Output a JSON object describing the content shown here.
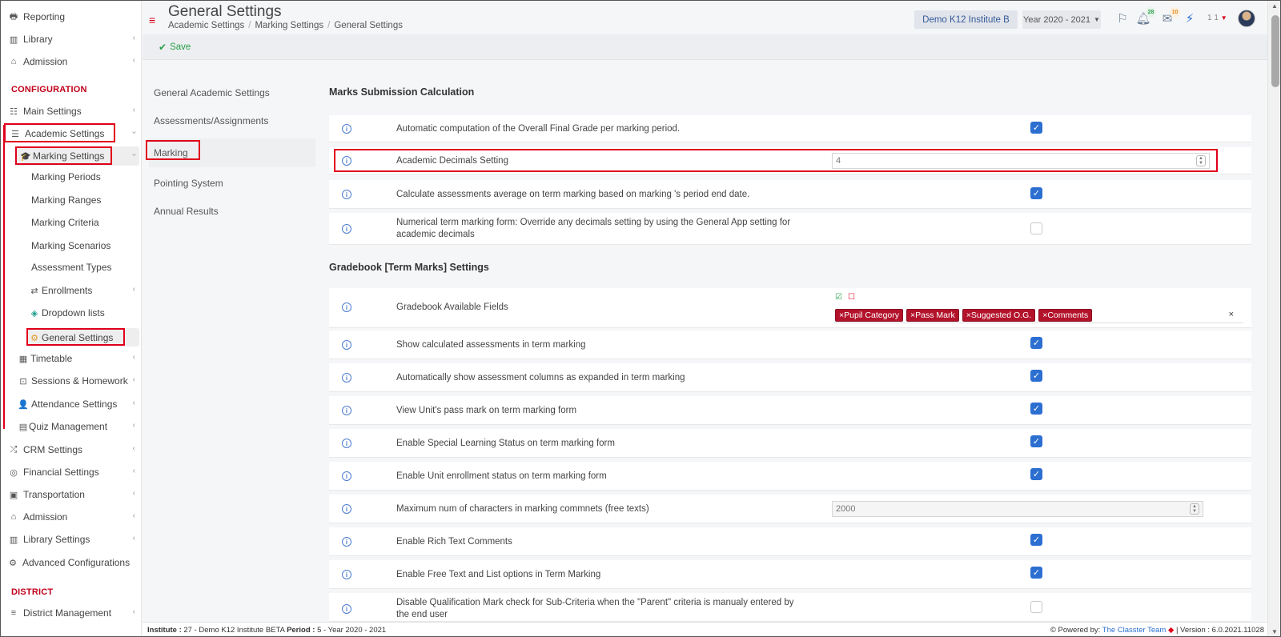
{
  "sidebar": {
    "top_items": [
      {
        "label": "Reporting",
        "icon": "printer-icon"
      },
      {
        "label": "Library",
        "icon": "library-icon"
      },
      {
        "label": "Admission",
        "icon": "institution-icon"
      }
    ],
    "section_configuration": "CONFIGURATION",
    "main_settings": "Main Settings",
    "academic_settings": "Academic Settings",
    "marking_settings": "Marking Settings",
    "marking_sub": [
      "Marking Periods",
      "Marking Ranges",
      "Marking Criteria",
      "Marking Scenarios",
      "Assessment Types"
    ],
    "enrollments": "Enrollments",
    "dropdown_lists": "Dropdown lists",
    "general_settings": "General Settings",
    "timetable": "Timetable",
    "sessions_homework": "Sessions & Homework",
    "attendance_settings": "Attendance Settings",
    "quiz_management": "Quiz Management",
    "crm_settings": "CRM Settings",
    "financial_settings": "Financial Settings",
    "transportation": "Transportation",
    "admission2": "Admission",
    "library_settings": "Library Settings",
    "advanced_configurations": "Advanced Configurations",
    "section_district": "DISTRICT",
    "district_management": "District Management"
  },
  "header": {
    "title": "General Settings",
    "breadcrumb": [
      "Academic Settings",
      "Marking Settings",
      "General Settings"
    ],
    "institute": "Demo K12 Institute B",
    "year": "Year 2020 - 2021",
    "notifications_count": "28",
    "messages_count": "10",
    "user_short": "1 1"
  },
  "toolbar": {
    "save_label": "Save"
  },
  "subnav": [
    "General Academic Settings",
    "Assessments/Assignments",
    "Marking",
    "Pointing System",
    "Annual Results"
  ],
  "sections": {
    "marks_title": "Marks Submission Calculation",
    "gradebook_title": "Gradebook [Term Marks] Settings"
  },
  "marks_rows": [
    {
      "label": "Automatic computation of the Overall Final Grade per marking period.",
      "checked": true
    },
    {
      "label": "Academic Decimals Setting",
      "value": "4"
    },
    {
      "label": "Calculate assessments average on term marking based on marking 's period end date.",
      "checked": true
    },
    {
      "label": "Numerical term marking form: Override any decimals setting by using the General App setting for academic decimals",
      "checked": false
    }
  ],
  "gradebook_fields": {
    "label": "Gradebook Available Fields",
    "tags": [
      "Pupil Category",
      "Pass Mark",
      "Suggested O.G.",
      "Comments"
    ]
  },
  "gradebook_rows": [
    {
      "label": "Show calculated assessments in term marking",
      "checked": true
    },
    {
      "label": "Automatically show assessment columns as expanded in term marking",
      "checked": true
    },
    {
      "label": "View Unit's pass mark on term marking form",
      "checked": true
    },
    {
      "label": "Enable Special Learning Status on term marking form",
      "checked": true
    },
    {
      "label": "Enable Unit enrollment status on term marking form",
      "checked": true
    },
    {
      "label": "Maximum num of characters in marking commnets (free texts)",
      "value": "2000"
    },
    {
      "label": "Enable Rich Text Comments",
      "checked": true
    },
    {
      "label": "Enable Free Text and List options in Term Marking",
      "checked": true
    },
    {
      "label": "Disable Qualification Mark check for Sub-Criteria when the \"Parent\" criteria is manualy entered by the end user",
      "checked": false
    }
  ],
  "footer": {
    "institute_label": "Institute :",
    "institute_value": "27 - Demo K12 Institute BETA",
    "period_label": "Period :",
    "period_value": "5 - Year 2020 - 2021",
    "powered_by": "Powered by:",
    "brand": "The Classter Team",
    "version": "| Version : 6.0.2021.11028"
  },
  "colors": {
    "accent_red": "#e0001b",
    "checkbox_blue": "#2c6fd1",
    "tag_red": "#b3122b"
  }
}
